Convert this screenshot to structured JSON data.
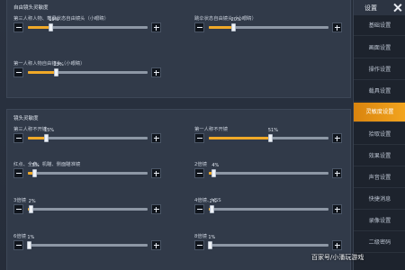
{
  "sidebar": {
    "title": "设置",
    "items": [
      {
        "label": "基础设置",
        "active": false
      },
      {
        "label": "画面设置",
        "active": false
      },
      {
        "label": "操作设置",
        "active": false
      },
      {
        "label": "载具设置",
        "active": false
      },
      {
        "label": "灵敏度设置",
        "active": true
      },
      {
        "label": "拾取设置",
        "active": false
      },
      {
        "label": "效果设置",
        "active": false
      },
      {
        "label": "声音设置",
        "active": false
      },
      {
        "label": "快捷消息",
        "active": false
      },
      {
        "label": "录像设置",
        "active": false
      },
      {
        "label": "二级密码",
        "active": false
      }
    ]
  },
  "free_camera": {
    "title": "自由镜头灵敏度",
    "settings": [
      {
        "label": "第三人称人物、载具状态自由镜头（小眼睛）",
        "value": "19%",
        "percent": 19
      },
      {
        "label": "跳伞状态自由镜头（小眼睛）",
        "value": "20%",
        "percent": 20
      },
      {
        "label": "第一人称人物自由镜头（小眼睛）",
        "value": "23%",
        "percent": 23
      }
    ]
  },
  "lens": {
    "title": "镜头灵敏度",
    "settings": [
      {
        "label": "第三人称不开镜",
        "value": "15%",
        "percent": 15
      },
      {
        "label": "第一人称不开镜",
        "value": "51%",
        "percent": 51
      },
      {
        "label": "红点、全息、机瞄、侧面瞄准镜",
        "value": "5%",
        "percent": 5
      },
      {
        "label": "2倍镜",
        "value": "4%",
        "percent": 4
      },
      {
        "label": "3倍镜",
        "value": "2%",
        "percent": 2
      },
      {
        "label": "4倍镜、VSS",
        "value": "2%",
        "percent": 2
      },
      {
        "label": "6倍镜",
        "value": "1%",
        "percent": 1
      },
      {
        "label": "8倍镜",
        "value": "1%",
        "percent": 1
      }
    ]
  },
  "watermark": "百家号/小潘玩游戏"
}
